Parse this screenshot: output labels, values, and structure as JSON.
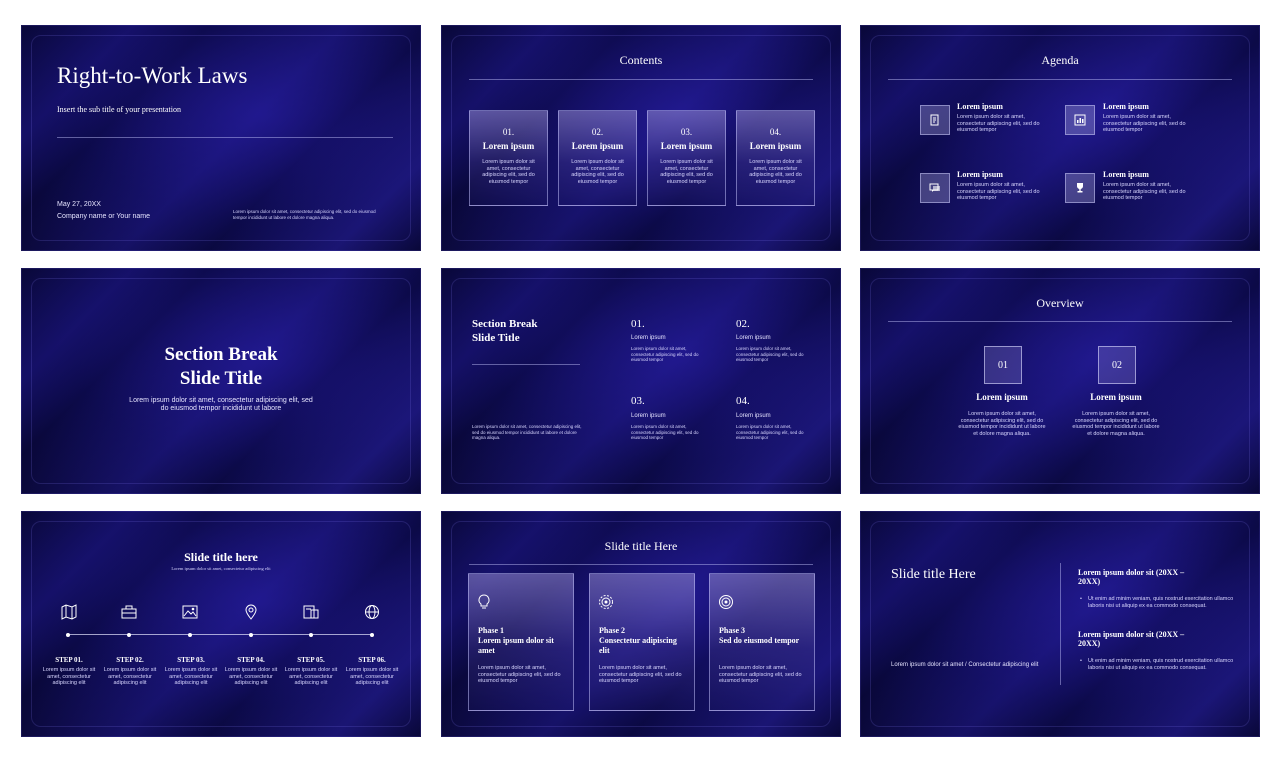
{
  "slide1": {
    "title": "Right-to-Work Laws",
    "subtitle": "Insert the sub title of your presentation",
    "date": "May 27, 20XX",
    "company": "Company name or Your name",
    "body": "Lorem ipsum dolor sit amet, consectetur adipiscing elit, sed do eiusmod tempor incididunt ut labore et dolore magna aliqua."
  },
  "slide2": {
    "title": "Contents",
    "cards": [
      {
        "num": "01.",
        "title": "Lorem ipsum",
        "text": "Lorem ipsum dolor sit amet, consectetur adipiscing elit, sed do eiusmod tempor"
      },
      {
        "num": "02.",
        "title": "Lorem ipsum",
        "text": "Lorem ipsum dolor sit amet, consectetur adipiscing elit, sed do eiusmod tempor"
      },
      {
        "num": "03.",
        "title": "Lorem ipsum",
        "text": "Lorem ipsum dolor sit amet, consectetur adipiscing elit, sed do eiusmod tempor"
      },
      {
        "num": "04.",
        "title": "Lorem ipsum",
        "text": "Lorem ipsum dolor sit amet, consectetur adipiscing elit, sed do eiusmod tempor"
      }
    ]
  },
  "slide3": {
    "title": "Agenda",
    "items": [
      {
        "title": "Lorem ipsum",
        "text": "Lorem ipsum dolor sit amet, consectetur adipiscing elit, sed do eiusmod tempor",
        "icon": "document-icon"
      },
      {
        "title": "Lorem ipsum",
        "text": "Lorem ipsum dolor sit amet, consectetur adipiscing elit, sed do eiusmod tempor",
        "icon": "chart-icon"
      },
      {
        "title": "Lorem ipsum",
        "text": "Lorem ipsum dolor sit amet, consectetur adipiscing elit, sed do eiusmod tempor",
        "icon": "chat-icon"
      },
      {
        "title": "Lorem ipsum",
        "text": "Lorem ipsum dolor sit amet, consectetur adipiscing elit, sed do eiusmod tempor",
        "icon": "trophy-icon"
      }
    ]
  },
  "slide4": {
    "title_line1": "Section Break",
    "title_line2": "Slide Title",
    "body": "Lorem ipsum dolor sit amet, consectetur adipiscing elit, sed do eiusmod tempor incididunt ut labore"
  },
  "slide5": {
    "title_line1": "Section Break",
    "title_line2": "Slide Title",
    "body": "Lorem ipsum dolor sit amet, consectetur adipiscing elit, sed do eiusmod tempor incididunt ut labore et dolore magna aliqua.",
    "items": [
      {
        "num": "01.",
        "label": "Lorem ipsum",
        "text": "Lorem ipsum dolor sit amet, consectetur adipiscing elit, sed do eiusmod tempor"
      },
      {
        "num": "02.",
        "label": "Lorem ipsum",
        "text": "Lorem ipsum dolor sit amet, consectetur adipiscing elit, sed do eiusmod tempor"
      },
      {
        "num": "03.",
        "label": "Lorem ipsum",
        "text": "Lorem ipsum dolor sit amet, consectetur adipiscing elit, sed do eiusmod tempor"
      },
      {
        "num": "04.",
        "label": "Lorem ipsum",
        "text": "Lorem ipsum dolor sit amet, consectetur adipiscing elit, sed do eiusmod tempor"
      }
    ]
  },
  "slide6": {
    "title": "Overview",
    "items": [
      {
        "num": "01",
        "title": "Lorem ipsum",
        "text": "Lorem ipsum dolor sit amet, consectetur adipiscing elit, sed do eiusmod tempor incididunt ut labore et dolore magna aliqua."
      },
      {
        "num": "02",
        "title": "Lorem ipsum",
        "text": "Lorem ipsum dolor sit amet, consectetur adipiscing elit, sed do eiusmod tempor incididunt ut labore et dolore magna aliqua."
      }
    ]
  },
  "slide7": {
    "title": "Slide title here",
    "subtitle": "Lorem ipsum dolor sit amet, consectetur adipiscing elit",
    "steps": [
      {
        "label": "STEP 01.",
        "text": "Lorem ipsum dolor sit amet, consectetur adipiscing elit",
        "icon": "map-icon"
      },
      {
        "label": "STEP 02.",
        "text": "Lorem ipsum dolor sit amet, consectetur adipiscing elit",
        "icon": "briefcase-icon"
      },
      {
        "label": "STEP 03.",
        "text": "Lorem ipsum dolor sit amet, consectetur adipiscing elit",
        "icon": "image-icon"
      },
      {
        "label": "STEP 04.",
        "text": "Lorem ipsum dolor sit amet, consectetur adipiscing elit",
        "icon": "location-pin-icon"
      },
      {
        "label": "STEP 05.",
        "text": "Lorem ipsum dolor sit amet, consectetur adipiscing elit",
        "icon": "devices-icon"
      },
      {
        "label": "STEP 06.",
        "text": "Lorem ipsum dolor sit amet, consectetur adipiscing elit",
        "icon": "globe-icon"
      }
    ]
  },
  "slide8": {
    "title": "Slide title Here",
    "phases": [
      {
        "label": "Phase 1",
        "title": "Lorem ipsum dolor sit amet",
        "text": "Lorem ipsum dolor sit amet, consectetur adipiscing elit, sed do eiusmod tempor",
        "icon": "lightbulb-icon"
      },
      {
        "label": "Phase 2",
        "title": "Consectetur adipiscing elit",
        "text": "Lorem ipsum dolor sit amet, consectetur adipiscing elit, sed do eiusmod tempor",
        "icon": "gear-icon"
      },
      {
        "label": "Phase 3",
        "title": "Sed do eiusmod tempor",
        "text": "Lorem ipsum dolor sit amet, consectetur adipiscing elit, sed do eiusmod tempor",
        "icon": "target-icon"
      }
    ]
  },
  "slide9": {
    "title": "Slide title Here",
    "body": "Lorem ipsum dolor sit amet / Consectetur adipiscing elit",
    "entries": [
      {
        "title": "Lorem ipsum dolor sit (20XX – 20XX)",
        "text": "Ut enim ad minim veniam, quis nostrud exercitation ullamco laboris nisi ut aliquip ex ea commodo consequat."
      },
      {
        "title": "Lorem ipsum dolor sit (20XX – 20XX)",
        "text": "Ut enim ad minim veniam, quis nostrud exercitation ullamco laboris nisi ut aliquip ex ea commodo consequat."
      }
    ]
  }
}
